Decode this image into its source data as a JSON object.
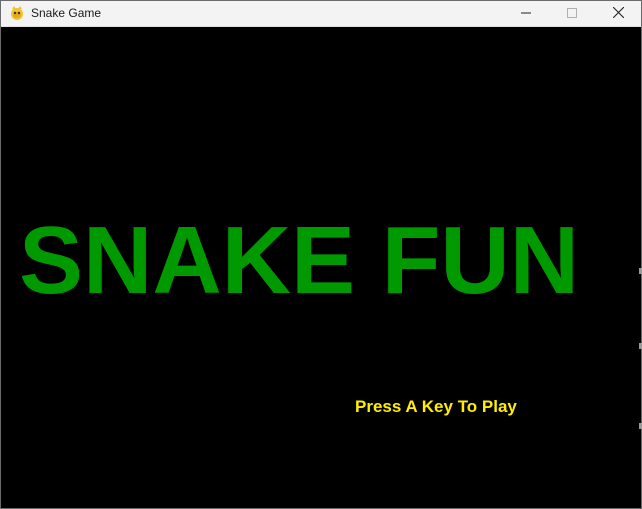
{
  "window": {
    "title": "Snake Game",
    "app_icon": "pygame-snake-icon",
    "controls": {
      "minimize_icon": "minimize-icon",
      "maximize_icon": "maximize-icon",
      "close_icon": "close-icon"
    }
  },
  "game": {
    "title": "SNAKE FUN",
    "prompt": "Press A Key To Play",
    "colors": {
      "background": "#000000",
      "title": "#009900",
      "prompt": "#ffee00"
    }
  }
}
